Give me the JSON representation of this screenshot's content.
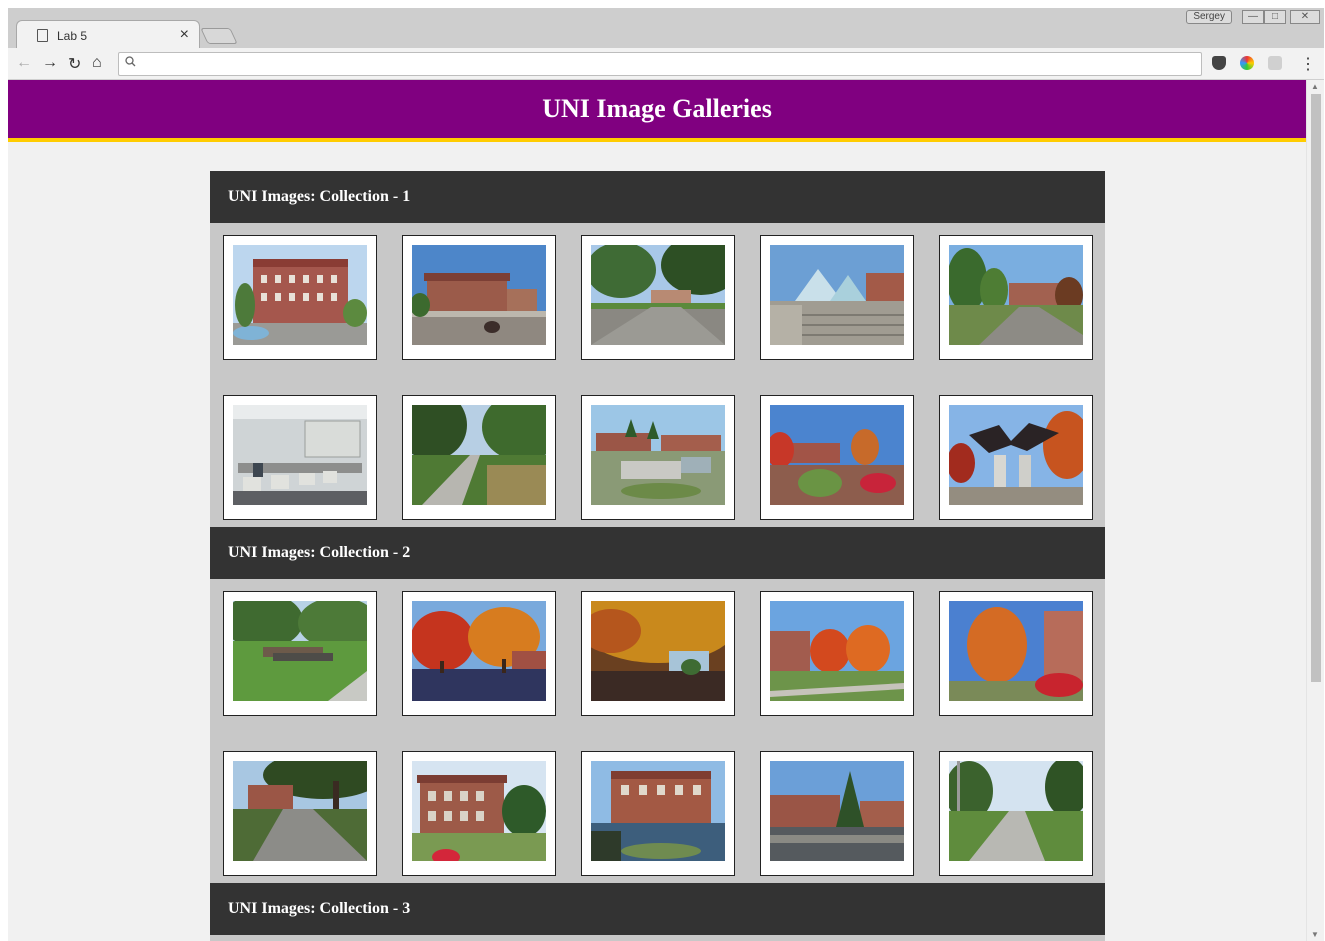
{
  "browser": {
    "tab_title": "Lab 5",
    "tab_close": "×",
    "user_badge": "Sergey",
    "window_buttons": [
      "—",
      "□",
      "✕"
    ],
    "omnibox_value": "",
    "nav": {
      "back": "←",
      "forward": "→",
      "reload": "↻",
      "home": "⌂",
      "menu": "⋮"
    },
    "search_glyph": "🔍"
  },
  "page": {
    "title": "UNI Image Galleries",
    "colors": {
      "header": "#800080",
      "accent": "#ffcc00",
      "section": "#333333",
      "panel": "#c8c8c8"
    }
  },
  "collections": [
    {
      "title": "UNI Images: Collection - 1",
      "photos": [
        "brick-building-fountain",
        "building-plaza",
        "trees-walkway",
        "glass-pyramid-steps",
        "campus-lawn-trees",
        "computer-lab",
        "tree-lined-path",
        "campus-courtyard",
        "autumn-flowerbeds",
        "bird-sculpture"
      ]
    },
    {
      "title": "UNI Images: Collection - 2",
      "photos": [
        "cannon-lawn",
        "autumn-trees-red",
        "autumn-canopy",
        "autumn-trees-buildings",
        "autumn-tree-building",
        "shaded-walkway",
        "brick-hall-tree",
        "brick-hall-plaza",
        "brick-hall-spruce",
        "long-sidewalk"
      ]
    },
    {
      "title": "UNI Images: Collection - 3",
      "photos": []
    }
  ]
}
